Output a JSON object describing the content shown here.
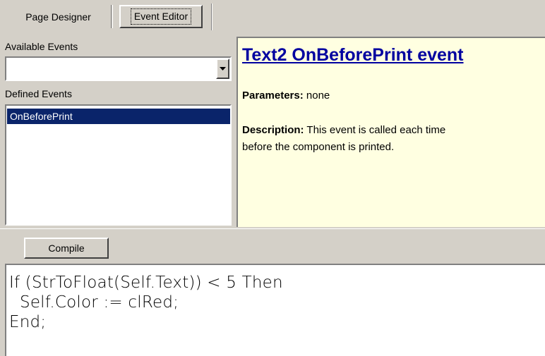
{
  "tabs": [
    {
      "label": "Page Designer",
      "active": false
    },
    {
      "label": "Event Editor",
      "active": true
    }
  ],
  "available_events": {
    "label": "Available Events",
    "value": ""
  },
  "defined_events": {
    "label": "Defined Events",
    "items": [
      "OnBeforePrint"
    ],
    "selected": "OnBeforePrint"
  },
  "help": {
    "title": "Text2 OnBeforePrint event",
    "parameters_label": "Parameters:",
    "parameters_value": "none",
    "description_label": "Description:",
    "description_line1": "This event is called each time",
    "description_line2": "before the component is printed."
  },
  "toolbar": {
    "compile_label": "Compile"
  },
  "editor": {
    "lines": [
      "If (StrToFloat(Self.Text)) < 5 Then",
      "  Self.Color := clRed;",
      "End;"
    ]
  },
  "colors": {
    "selection": "#0a246a",
    "help_background": "#ffffe1",
    "help_title": "#0000a0",
    "window_face": "#d4d0c8"
  },
  "icons": {
    "combo_button": "chevron-down-icon"
  }
}
